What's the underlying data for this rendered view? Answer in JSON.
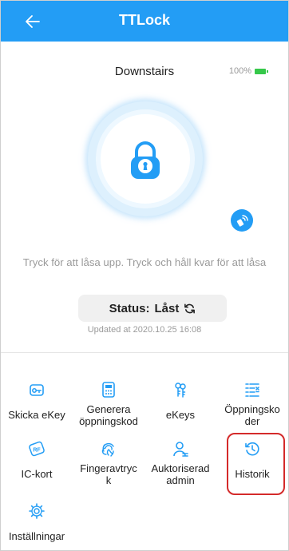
{
  "header": {
    "title": "TTLock"
  },
  "lock": {
    "name": "Downstairs",
    "battery": "100%",
    "hint": "Tryck för att låsa upp. Tryck och håll kvar för att låsa",
    "status_label": "Status:",
    "status_value": "Låst",
    "updated": "Updated at 2020.10.25 16:08"
  },
  "colors": {
    "accent": "#239df5",
    "highlight": "#d42a2a",
    "battery": "#36c84a"
  },
  "menu": [
    {
      "label": "Skicka eKey",
      "icon": "key-card-icon"
    },
    {
      "label": "Generera öppningskod",
      "icon": "calculator-icon"
    },
    {
      "label": "eKeys",
      "icon": "keys-icon"
    },
    {
      "label": "Öppningskoder",
      "icon": "passcode-list-icon"
    },
    {
      "label": "IC-kort",
      "icon": "rf-card-icon"
    },
    {
      "label": "Fingeravtryck",
      "icon": "fingerprint-icon"
    },
    {
      "label": "Auktoriserad admin",
      "icon": "admin-user-icon"
    },
    {
      "label": "Historik",
      "icon": "history-icon"
    },
    {
      "label": "Inställningar",
      "icon": "settings-gear-icon"
    }
  ]
}
